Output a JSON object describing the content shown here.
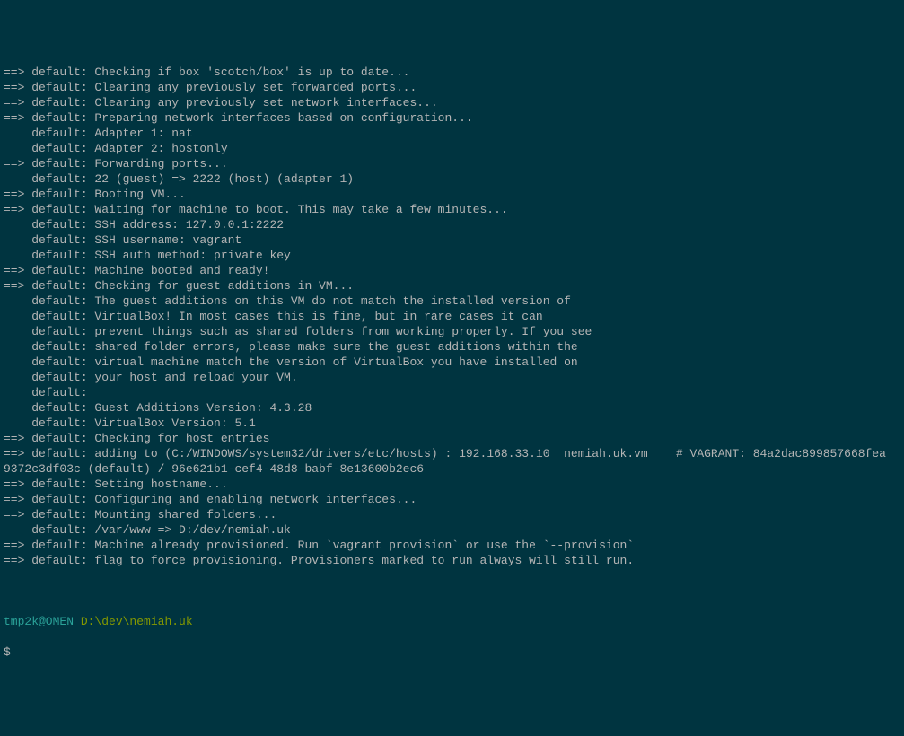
{
  "lines": [
    "==> default: Checking if box 'scotch/box' is up to date...",
    "==> default: Clearing any previously set forwarded ports...",
    "==> default: Clearing any previously set network interfaces...",
    "==> default: Preparing network interfaces based on configuration...",
    "    default: Adapter 1: nat",
    "    default: Adapter 2: hostonly",
    "==> default: Forwarding ports...",
    "    default: 22 (guest) => 2222 (host) (adapter 1)",
    "==> default: Booting VM...",
    "==> default: Waiting for machine to boot. This may take a few minutes...",
    "    default: SSH address: 127.0.0.1:2222",
    "    default: SSH username: vagrant",
    "    default: SSH auth method: private key",
    "==> default: Machine booted and ready!",
    "==> default: Checking for guest additions in VM...",
    "    default: The guest additions on this VM do not match the installed version of",
    "    default: VirtualBox! In most cases this is fine, but in rare cases it can",
    "    default: prevent things such as shared folders from working properly. If you see",
    "    default: shared folder errors, please make sure the guest additions within the",
    "    default: virtual machine match the version of VirtualBox you have installed on",
    "    default: your host and reload your VM.",
    "    default:",
    "    default: Guest Additions Version: 4.3.28",
    "    default: VirtualBox Version: 5.1",
    "==> default: Checking for host entries",
    "==> default: adding to (C:/WINDOWS/system32/drivers/etc/hosts) : 192.168.33.10  nemiah.uk.vm    # VAGRANT: 84a2dac899857668fea",
    "9372c3df03c (default) / 96e621b1-cef4-48d8-babf-8e13600b2ec6",
    "==> default: Setting hostname...",
    "==> default: Configuring and enabling network interfaces...",
    "==> default: Mounting shared folders...",
    "    default: /var/www => D:/dev/nemiah.uk",
    "==> default: Machine already provisioned. Run `vagrant provision` or use the `--provision`",
    "==> default: flag to force provisioning. Provisioners marked to run always will still run."
  ],
  "prompt": {
    "user": "tmp2k@OMEN",
    "sep": " ",
    "path": "D:\\dev\\nemiah.uk"
  },
  "cursor": "$"
}
